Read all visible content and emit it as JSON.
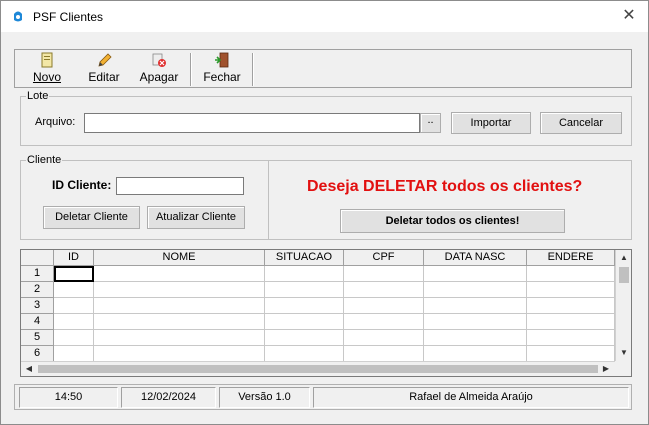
{
  "window": {
    "title": "PSF Clientes",
    "close_glyph": "✕"
  },
  "toolbar": {
    "novo_label": "Novo",
    "editar_label": "Editar",
    "apagar_label": "Apagar",
    "fechar_label": "Fechar"
  },
  "lote": {
    "legend": "Lote",
    "arquivo_label": "Arquivo:",
    "arquivo_value": "",
    "browse_label": "..",
    "importar_label": "Importar",
    "cancelar_label": "Cancelar"
  },
  "cliente": {
    "legend": "Cliente",
    "id_label": "ID Cliente:",
    "id_value": "",
    "deletar_label": "Deletar Cliente",
    "atualizar_label": "Atualizar Cliente",
    "warning": "Deseja DELETAR todos os clientes?",
    "deletar_todos_label": "Deletar todos os clientes!",
    "warning_color": "#e21010"
  },
  "grid": {
    "columns": [
      "ID",
      "NOME",
      "SITUACAO",
      "CPF",
      "DATA NASC",
      "ENDERE"
    ],
    "rows": [
      "1",
      "2",
      "3",
      "4",
      "5",
      "6"
    ]
  },
  "status": {
    "time": "14:50",
    "date": "12/02/2024",
    "version": "Versão 1.0",
    "author": "Rafael de Almeida Araújo"
  },
  "icons": {
    "app": "app-icon",
    "novo": "new-document-icon",
    "editar": "pencil-icon",
    "apagar": "delete-icon",
    "fechar": "exit-door-icon"
  }
}
